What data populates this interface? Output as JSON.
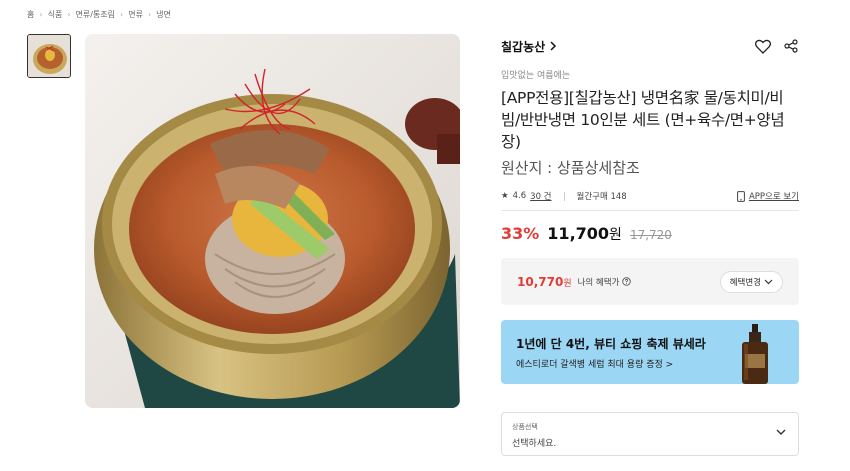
{
  "breadcrumb": [
    "홈",
    "식품",
    "면류/통조림",
    "면류",
    "냉면"
  ],
  "brand": {
    "name": "칠갑농산"
  },
  "icons": {
    "like": "heart-icon",
    "share": "share-icon",
    "brand_link": "chevron-right-icon",
    "phone": "phone-icon",
    "info": "info-icon",
    "dropdown": "chevron-down-icon"
  },
  "product": {
    "promo_text": "입맛없는 여름에는",
    "title": "[APP전용][칠갑농산] 냉면名家 물/동치미/비빔/반반냉면 10인분 세트 (면+육수/면+양념장)",
    "origin": "원산지 : 상품상세참조"
  },
  "meta": {
    "rating": "4.6",
    "review_count": "30 건",
    "monthly_purchase": "월간구매 148",
    "app_view": "APP으로 보기"
  },
  "price": {
    "discount": "33%",
    "sale_price": "11,700",
    "currency": "원",
    "original_price": "17,720"
  },
  "benefit": {
    "price": "10,770",
    "currency": "원",
    "label": "나의 혜택가",
    "button": "혜택변경"
  },
  "banner": {
    "title": "1년에 단 4번, 뷰티 쇼핑 축제 뷰세라",
    "subtitle": "에스티로더 갈색병 세럼 최대 용량 증정 >"
  },
  "option_select": {
    "label": "상품선택",
    "value": "선택하세요."
  },
  "colors": {
    "accent_red": "#e33c36",
    "banner_bg": "#9bd7f5"
  }
}
